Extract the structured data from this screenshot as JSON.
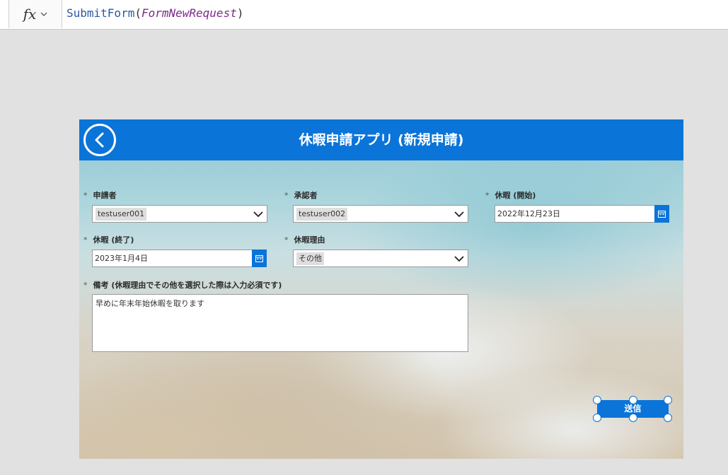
{
  "formula_bar": {
    "fx_label": "fx",
    "function_name": "SubmitForm",
    "open_paren": "(",
    "argument": "FormNewRequest",
    "close_paren": ")"
  },
  "app": {
    "title": "休暇申請アプリ (新規申請)",
    "required_mark": "*",
    "fields": {
      "applicant": {
        "label": "申請者",
        "value": "testuser001"
      },
      "approver": {
        "label": "承認者",
        "value": "testuser002"
      },
      "leave_start": {
        "label": "休暇 (開始)",
        "value": "2022年12月23日"
      },
      "leave_end": {
        "label": "休暇 (終了)",
        "value": "2023年1月4日"
      },
      "leave_reason": {
        "label": "休暇理由",
        "value": "その他"
      },
      "remarks": {
        "label": "備考 (休暇理由でその他を選択した際は入力必須です)",
        "value": "早めに年末年始休暇を取ります"
      }
    },
    "submit_label": "送信"
  },
  "colors": {
    "accent": "#0b74d8",
    "canvas_bg": "#e1e1e1"
  },
  "icons": [
    "chevron-down-icon",
    "back-arrow-icon",
    "calendar-icon"
  ]
}
